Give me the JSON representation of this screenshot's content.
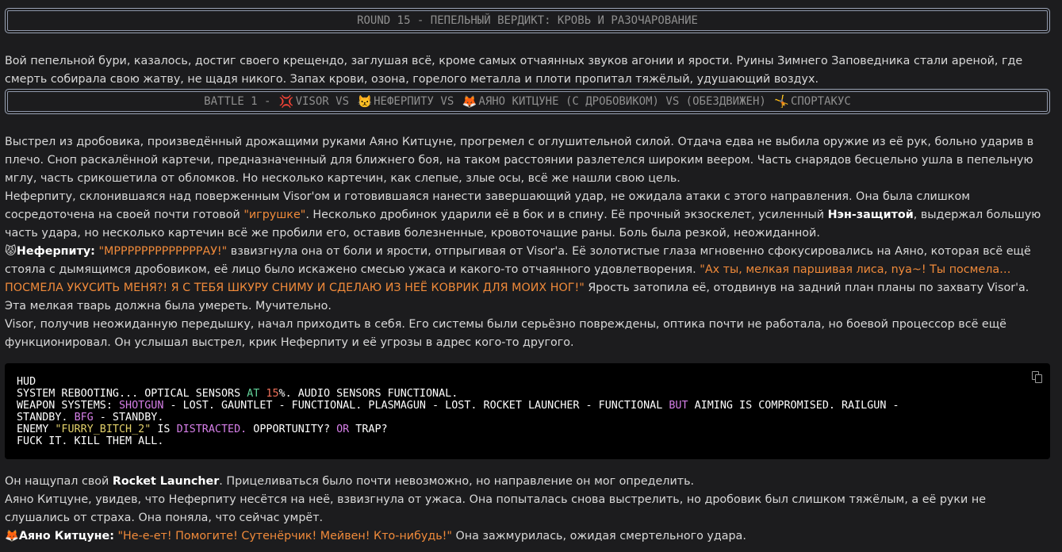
{
  "round_banner": "ROUND 15 - ПЕПЕЛЬНЫЙ ВЕРДИКТ: КРОВЬ И РАЗОЧАРОВАНИЕ",
  "intro": "Вой пепельной бури, казалось, достиг своего крещендо, заглушая всё, кроме самых отчаянных звуков агонии и ярости. Руины Зимнего Заповедника стали ареной, где смерть собирала свою жатву, не щадя никого. Запах крови, озона, горелого металла и плоти пропитал тяжёлый, удушающий воздух.",
  "battle_banner": {
    "prefix": "BATTLE 1 - ",
    "fighter1_icon": "💢",
    "fighter1": "VISOR VS ",
    "fighter2_icon": "😾",
    "fighter2": "НЕФЕРПИТУ VS ",
    "fighter3_icon": "🦊",
    "fighter3": "АЯНО КИТЦУНЕ (С ДРОБОВИКОМ) VS (ОБЕЗДВИЖЕН) ",
    "fighter4_icon": "🤸",
    "fighter4": "СПОРТАКУС"
  },
  "story": {
    "p1": "Выстрел из дробовика, произведённый дрожащими руками Аяно Китцуне, прогремел с оглушительной силой. Отдача едва не выбила оружие из её рук, больно ударив в плечо. Сноп раскалённой картечи, предназначенный для ближнего боя, на таком расстоянии разлетелся широким веером. Часть снарядов бесцельно ушла в пепельную мглу, часть срикошетила от обломков. Но несколько картечин, как слепые, злые осы, всё же нашли свою цель.",
    "p2a": "Неферпиту, склонившаяся над поверженным Visor'ом и готовившаяся нанести завершающий удар, не ожидала атаки с этого направления. Она была слишком сосредоточена на своей почти готовой ",
    "p2_quote": "\"игрушке\"",
    "p2b": ". Несколько дробинок ударили её в бок и в спину. Её прочный экзоскелет, усиленный ",
    "p2_bold": "Нэн-защитой",
    "p2c": ", выдержал большую часть удара, но несколько картечин всё же пробили его, оставив болезненные, кровоточащие раны. Боль была резкой, неожиданной.",
    "p3_icon": "😾",
    "p3_speaker": "Неферпиту:",
    "p3_quote1": "\"МРРРРРРРРРРРРРАУ!\"",
    "p3a": " взвизгнула она от боли и ярости, отпрыгивая от Visor'а. Её золотистые глаза мгновенно сфокусировались на Аяно, которая всё ещё стояла с дымящимся дробовиком, её лицо было искажено смесью ужаса и какого-то отчаянного удовлетворения. ",
    "p3_quote2": "\"Ах ты, мелкая паршивая лиса, nya~! Ты посмела… ПОСМЕЛА УКУСИТЬ МЕНЯ?! Я С ТЕБЯ ШКУРУ СНИМУ И СДЕЛАЮ ИЗ НЕЁ КОВРИК ДЛЯ МОИХ НОГ!\"",
    "p3b": " Ярость затопила её, отодвинув на задний план планы по захвату Visor'а. Эта мелкая тварь должна была умереть. Мучительно.",
    "p4": "Visor, получив неожиданную передышку, начал приходить в себя. Его системы были серьёзно повреждены, оптика почти не работала, но боевой процессор всё ещё функционировал. Он услышал выстрел, крик Неферпиту и её угрозы в адрес кого-то другого."
  },
  "hud": {
    "l1": "HUD",
    "l2a": "SYSTEM REBOOTING... OPTICAL SENSORS ",
    "l2_at": "AT",
    "l2_num": "15",
    "l2b": "%. AUDIO SENSORS FUNCTIONAL.",
    "l3a": "WEAPON SYSTEMS: ",
    "l3_shotgun": "SHOTGUN",
    "l3b": " - LOST. GAUNTLET - FUNCTIONAL. PLASMAGUN - LOST. ROCKET LAUNCHER - FUNCTIONAL ",
    "l3_but": "BUT",
    "l3c": " AIMING IS COMPROMISED. RAILGUN -",
    "l4a": "STANDBY. ",
    "l4_bfg": "BFG",
    "l4b": " - STANDBY.",
    "l5a": "ENEMY ",
    "l5_name": "\"FURRY_BITCH_2\"",
    "l5b": " IS ",
    "l5_distracted": "DISTRACTED.",
    "l5c": " OPPORTUNITY? ",
    "l5_or": "OR",
    "l5d": " TRAP?",
    "l6": "FUCK IT. KILL THEM ALL."
  },
  "after": {
    "p5a": "Он нащупал свой ",
    "p5_bold": "Rocket Launcher",
    "p5b": ". Прицеливаться было почти невозможно, но направление он мог определить.",
    "p6": "Аяно Китцуне, увидев, что Неферпиту несётся на неё, взвизгнула от ужаса. Она попыталась снова выстрелить, но дробовик был слишком тяжёлым, а её руки не слушались от страха. Она поняла, что сейчас умрёт.",
    "p7_icon": "🦊",
    "p7_speaker": "Аяно Китцуне:",
    "p7_quote": "\"Не-е-ет! Помогите! Сутенёрчик! Мейвен! Кто-нибудь!\"",
    "p7b": " Она зажмурилась, ожидая смертельного удара."
  },
  "colors": {
    "quote": "#f08a3a",
    "hud_green": "#63d29a",
    "hud_red": "#f0705a",
    "hud_purple": "#d67fe8",
    "hud_yellow": "#e2d06a"
  },
  "icons": {
    "copy": "copy-icon"
  }
}
